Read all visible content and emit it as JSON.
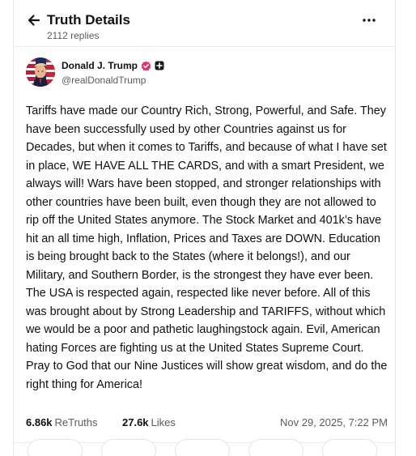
{
  "header": {
    "title": "Truth Details",
    "replies": "2112 replies",
    "back_icon": "arrow-left-icon",
    "more_icon": "more-horizontal-icon"
  },
  "author": {
    "name": "Donald J. Trump",
    "handle": "@realDonaldTrump",
    "verified_color": "#e2336b",
    "badge_icon": "plus-square-badge-icon"
  },
  "post": {
    "text": "Tariffs have made our Country Rich, Strong, Powerful, and Safe. They have been successfully used by other Countries against us for Decades, but when it comes to Tariffs, and because of what I have set in place, WE HAVE ALL THE CARDS, and with a smart President, we always will! Wars have been stopped, and stronger relationships with other countries have been built, even though they are not allowed to rip off the United States anymore. The Stock Market and 401k’s have hit an all time high, Inflation, Prices and Taxes are DOWN. Education is being brought back to the States (where it belongs!), and our Military, and Southern Border, is the strongest they have ever been. The USA is respected again, respected like never before. All of this was brought about by Strong Leadership and TARIFFS, without which we would be a poor and pathetic laughingstock again. Evil, American hating Forces are fighting us at the United States Supreme Court. Pray to God that our Nine Justices will show great wisdom, and do the right thing for America!"
  },
  "stats": {
    "retruths_count": "6.86k",
    "retruths_label": "ReTruths",
    "likes_count": "27.6k",
    "likes_label": "Likes",
    "timestamp": "Nov 29, 2025, 7:22 PM"
  },
  "colors": {
    "text": "#0f0f14",
    "muted": "#5b5b66",
    "divider": "#ececf0"
  }
}
